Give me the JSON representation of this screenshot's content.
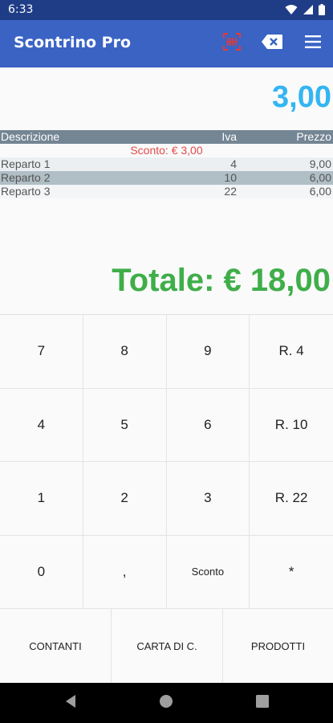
{
  "status_bar": {
    "time": "6:33"
  },
  "app_bar": {
    "title": "Scontrino Pro"
  },
  "current_amount": "3,00",
  "table": {
    "headers": {
      "descrizione": "Descrizione",
      "iva": "Iva",
      "prezzo": "Prezzo"
    },
    "sconto": "Sconto: € 3,00",
    "rows": [
      {
        "desc": "Reparto 1",
        "iva": "4",
        "prezzo": "9,00"
      },
      {
        "desc": "Reparto 2",
        "iva": "10",
        "prezzo": "6,00"
      },
      {
        "desc": "Reparto 3",
        "iva": "22",
        "prezzo": "6,00"
      }
    ]
  },
  "total": "Totale: € 18,00",
  "keypad": {
    "k7": "7",
    "k8": "8",
    "k9": "9",
    "r4": "R. 4",
    "k4": "4",
    "k5": "5",
    "k6": "6",
    "r10": "R. 10",
    "k1": "1",
    "k2": "2",
    "k3": "3",
    "r22": "R. 22",
    "k0": "0",
    "comma": ",",
    "sconto": "Sconto",
    "multiply": "*"
  },
  "bottom": {
    "contanti": "CONTANTI",
    "carta": "CARTA DI C.",
    "prodotti": "PRODOTTI"
  },
  "colors": {
    "status_bar": "#1f3d87",
    "app_bar": "#3a63c4",
    "amount": "#33b5f2",
    "total": "#3fae49",
    "sconto": "#e64a4a",
    "barcode_icon": "#e53935"
  },
  "icons": {
    "wifi": "wifi-icon",
    "signal": "signal-icon",
    "battery": "battery-icon",
    "barcode": "barcode-scan-icon",
    "backspace": "backspace-icon",
    "menu": "menu-icon",
    "back": "nav-back-icon",
    "home": "nav-home-icon",
    "recents": "nav-recents-icon"
  }
}
